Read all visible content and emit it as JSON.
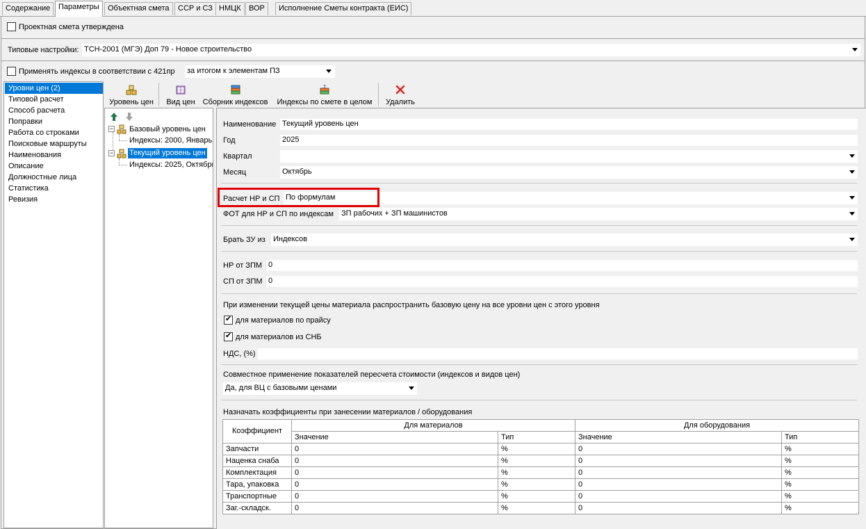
{
  "tabs": [
    "Содержание",
    "Параметры",
    "Объектная смета",
    "ССР и СЗ",
    "НМЦК",
    "ВОР",
    "Исполнение Сметы контракта (ЕИС)"
  ],
  "approved_label": "Проектная смета утверждена",
  "typical_settings": {
    "label": "Типовые настройки:",
    "value": "ТСН-2001 (МГЭ) Доп 79 - Новое строительство"
  },
  "apply_indexes": {
    "label": "Применять индексы в соответствии с 421пр",
    "value": "за итогом к элементам ПЗ"
  },
  "left_menu": [
    "Уровни цен (2)",
    "Типовой расчет",
    "Способ расчета",
    "Поправки",
    "Работа со строками",
    "Поисковые маршруты",
    "Наименования",
    "Описание",
    "Должностные лица",
    "Статистика",
    "Ревизия"
  ],
  "toolbar": {
    "price_level": "Уровень цен",
    "price_type": "Вид цен",
    "index_collection": "Сборник индексов",
    "index_whole": "Индексы по смете в целом",
    "delete": "Удалить"
  },
  "tree": {
    "base": "Базовый уровень цен",
    "base_child": "Индексы: 2000, Январь",
    "current": "Текущий уровень цен",
    "current_child": "Индексы: 2025, Октябрь"
  },
  "form": {
    "name_label": "Наименование",
    "name_value": "Текущий уровень цен",
    "year_label": "Год",
    "year_value": "2025",
    "quarter_label": "Квартал",
    "quarter_value": "",
    "month_label": "Месяц",
    "month_value": "Октябрь",
    "nr_sp_label": "Расчет НР и СП",
    "nr_sp_value": "По формулам",
    "fot_label": "ФОТ для НР и СП по индексам",
    "fot_value": "ЗП рабочих + ЗП машинистов",
    "zu_label": "Брать ЗУ из",
    "zu_value": "Индексов",
    "nr_zpm_label": "НР от ЗПМ",
    "nr_zpm_value": "0",
    "sp_zpm_label": "СП от ЗПМ",
    "sp_zpm_value": "0",
    "spread_label": "При изменении текущей цены материала распространить базовую цену на все уровни цен с этого уровня",
    "chk_price_label": "для материалов по прайсу",
    "chk_snb_label": "для материалов из СНБ",
    "nds_label": "НДС, (%)",
    "nds_value": "",
    "joint_label": "Совместное применение показателей пересчета стоимости (индексов и видов цен)",
    "joint_value": "Да, для ВЦ с базовыми ценами",
    "coef_label": "Назначать коэффициенты при занесении материалов / оборудования"
  },
  "table": {
    "col_coef": "Коэффициент",
    "col_materials": "Для материалов",
    "col_equipment": "Для оборудования",
    "col_value": "Значение",
    "col_type": "Тип",
    "rows": [
      {
        "name": "Запчасти",
        "mv": "0",
        "mt": "%",
        "ev": "0",
        "et": "%"
      },
      {
        "name": "Наценка снаба",
        "mv": "0",
        "mt": "%",
        "ev": "0",
        "et": "%"
      },
      {
        "name": "Комплектация",
        "mv": "0",
        "mt": "%",
        "ev": "0",
        "et": "%"
      },
      {
        "name": "Тара, упаковка",
        "mv": "0",
        "mt": "%",
        "ev": "0",
        "et": "%"
      },
      {
        "name": "Транспортные",
        "mv": "0",
        "mt": "%",
        "ev": "0",
        "et": "%"
      },
      {
        "name": "Заг.-складск.",
        "mv": "0",
        "mt": "%",
        "ev": "0",
        "et": "%"
      }
    ]
  },
  "colors": {
    "selection": "#0078d7",
    "highlight_box": "#e00000"
  }
}
